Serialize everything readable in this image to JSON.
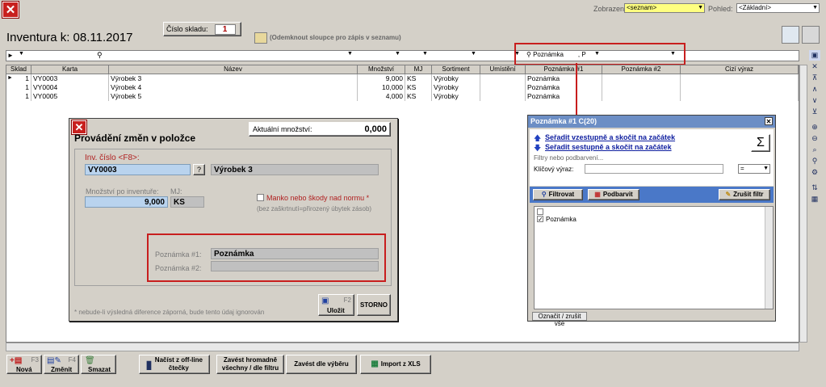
{
  "header": {
    "title": "Inventura k: 08.11.2017",
    "sklad_label": "Číslo skladu:",
    "sklad_value": "1",
    "hint": "(Odemknout sloupce pro zápis v seznamu)",
    "zobrazeni_label": "Zobrazení:",
    "zobrazeni_value": "<seznam>",
    "pohled_label": "Pohled:",
    "pohled_value": "<Základní>"
  },
  "filter": {
    "poznamka": "Poznámka",
    "p": ", P"
  },
  "grid": {
    "columns": [
      "Sklad",
      "Karta",
      "Název",
      "Množství",
      "MJ",
      "Sortiment",
      "Umístění",
      "Poznámka #1",
      "Poznámka #2",
      "Cizí výraz"
    ],
    "rows": [
      [
        "1",
        "VY0003",
        "Výrobek 3",
        "9,000",
        "KS",
        "Výrobky",
        "",
        "Poznámka",
        "",
        ""
      ],
      [
        "1",
        "VY0004",
        "Výrobek 4",
        "10,000",
        "KS",
        "Výrobky",
        "",
        "Poznámka",
        "",
        ""
      ],
      [
        "1",
        "VY0005",
        "Výrobek 5",
        "4,000",
        "KS",
        "Výrobky",
        "",
        "Poznámka",
        "",
        ""
      ]
    ]
  },
  "dialog": {
    "title": "Provádění změn v položce",
    "akt_label": "Aktuální množství:",
    "akt_value": "0,000",
    "inv_label": "Inv. číslo <F8>:",
    "inv_value": "VY0003",
    "q": "?",
    "nazev": "Výrobek 3",
    "mnozstvi_label": "Množství po inventuře:",
    "mj_label": "MJ:",
    "mnozstvi_value": "9,000",
    "mj_value": "KS",
    "manko_label": "Manko nebo škody nad normu *",
    "manko_note": "(bez zaškrtnutí=přirozený úbytek zásob)",
    "pozn1_label": "Poznámka #1:",
    "pozn1_value": "Poznámka",
    "pozn2_label": "Poznámka #2:",
    "pozn2_value": "",
    "footnote": "* nebude-li výsledná diference záporná, bude tento údaj ignorován",
    "f2": "F2",
    "ulozit": "Uložit",
    "storno": "STORNO"
  },
  "popup": {
    "title": "Poznámka #1 C(20)",
    "sort_asc": "Seřadit vzestupně a skočit na začátek",
    "sort_desc": "Seřadit sestupně a skočit na začátek",
    "filtry": "Filtry nebo podbarvení...",
    "klic_label": "Klíčový výraz:",
    "eq": "=",
    "filtrovat": "Filtrovat",
    "podbarvit": "Podbarvit",
    "zrusit": "Zrušit filtr",
    "item": "Poznámka",
    "oznacit": "Označit / zrušit vše",
    "sigma": "Σ"
  },
  "bottom": {
    "nova": "Nová",
    "nova_key": "F3",
    "zmenit": "Změnit",
    "zmenit_key": "F4",
    "smazat": "Smazat",
    "nacist": "Načíst z off-line čtečky",
    "zavest_hromadne": "Zavést hromadně všechny / dle filtru",
    "zavest_vyber": "Zavést dle výběru",
    "import": "Import z XLS"
  }
}
